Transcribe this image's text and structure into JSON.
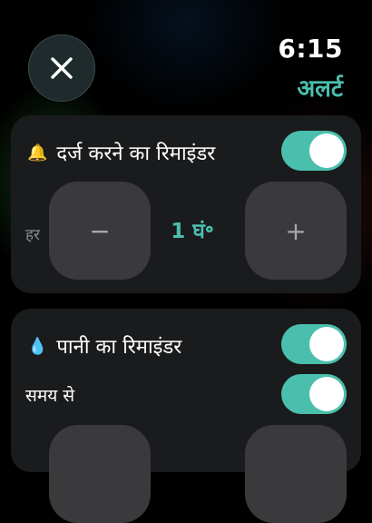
{
  "status": {
    "time": "6:15"
  },
  "header": {
    "title": "अलर्ट",
    "close_icon": "close-icon"
  },
  "colors": {
    "accent": "#4bbfae",
    "card": "#1a1b1c",
    "button": "#3a3a3c"
  },
  "log_reminder": {
    "emoji": "🔔",
    "title": "दर्ज करने का रिमाइंडर",
    "enabled": true,
    "interval_prefix": "हर",
    "minus_label": "−",
    "value": "1 घं॰",
    "plus_label": "+"
  },
  "water_reminder": {
    "emoji": "💧",
    "title": "पानी का रिमाइंडर",
    "enabled": true,
    "timed_label": "समय से",
    "timed_enabled": true
  }
}
